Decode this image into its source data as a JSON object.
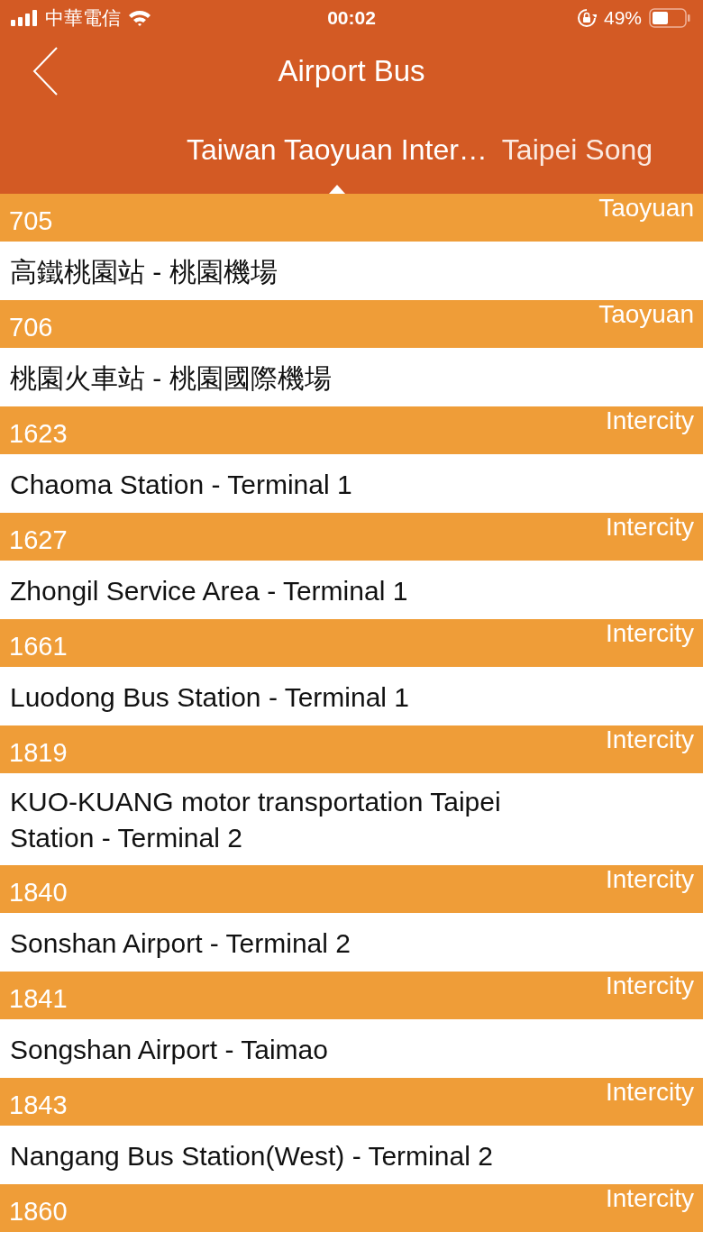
{
  "status_bar": {
    "carrier": "中華電信",
    "time": "00:02",
    "battery": "49%"
  },
  "nav": {
    "title": "Airport Bus"
  },
  "tabs": [
    {
      "label": "Taiwan Taoyuan Inter…",
      "selected": true
    },
    {
      "label": "Taipei Song",
      "selected": false
    }
  ],
  "routes": [
    {
      "number": "705",
      "category": "Taoyuan",
      "name": "高鐵桃園站 - 桃園機場"
    },
    {
      "number": "706",
      "category": "Taoyuan",
      "name": "桃園火車站 - 桃園國際機場"
    },
    {
      "number": "1623",
      "category": "Intercity",
      "name": "Chaoma Station - Terminal 1"
    },
    {
      "number": "1627",
      "category": "Intercity",
      "name": "Zhongil Service Area - Terminal 1"
    },
    {
      "number": "1661",
      "category": "Intercity",
      "name": "Luodong Bus Station - Terminal 1"
    },
    {
      "number": "1819",
      "category": "Intercity",
      "name": "KUO-KUANG motor transportation Taipei Station - Terminal 2"
    },
    {
      "number": "1840",
      "category": "Intercity",
      "name": "Sonshan Airport - Terminal 2"
    },
    {
      "number": "1841",
      "category": "Intercity",
      "name": "Songshan Airport - Taimao"
    },
    {
      "number": "1843",
      "category": "Intercity",
      "name": "Nangang Bus Station(West) - Terminal 2"
    },
    {
      "number": "1860",
      "category": "Intercity"
    }
  ]
}
